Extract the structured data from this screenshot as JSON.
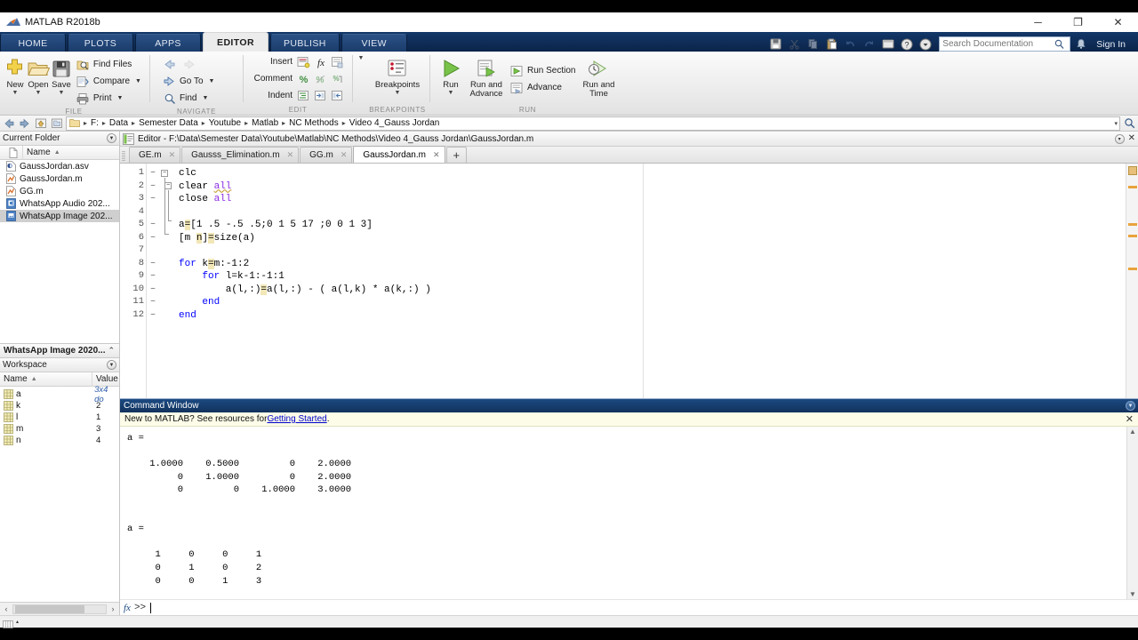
{
  "window": {
    "title": "MATLAB R2018b",
    "minimize": "─",
    "maximize": "❐",
    "close": "✕"
  },
  "ribbon_tabs": [
    {
      "label": "HOME",
      "active": false
    },
    {
      "label": "PLOTS",
      "active": false
    },
    {
      "label": "APPS",
      "active": false
    },
    {
      "label": "EDITOR",
      "active": true
    },
    {
      "label": "PUBLISH",
      "active": false
    },
    {
      "label": "VIEW",
      "active": false
    }
  ],
  "quickaccess": {
    "icons": [
      "save-icon",
      "cut-icon",
      "copy-icon",
      "paste-icon",
      "undo-icon",
      "redo-icon",
      "layout-icon",
      "help-icon",
      "more-icon"
    ],
    "search_placeholder": "Search Documentation",
    "search_value": "",
    "bell_icon": "notification-icon",
    "signin_label": "Sign In"
  },
  "ribbon": {
    "groups": [
      {
        "label": "FILE",
        "big": [
          {
            "label": "New",
            "icon": "new-file-icon",
            "has_caret": true
          },
          {
            "label": "Open",
            "icon": "open-folder-icon",
            "has_caret": true
          },
          {
            "label": "Save",
            "icon": "save-disk-icon",
            "has_caret": true
          }
        ],
        "small": [
          {
            "label": "Find Files",
            "icon": "find-files-icon",
            "caret": false
          },
          {
            "label": "Compare",
            "icon": "compare-icon",
            "caret": true
          },
          {
            "label": "Print",
            "icon": "print-icon",
            "caret": true
          }
        ]
      },
      {
        "label": "NAVIGATE",
        "small": [
          {
            "label": "",
            "icon": "back-arrow-icon",
            "caret": false,
            "dim": true
          },
          {
            "label": "Go To",
            "icon": "goto-icon",
            "caret": true
          },
          {
            "label": "Find",
            "icon": "find-magnifier-icon",
            "caret": true
          }
        ]
      },
      {
        "label": "EDIT",
        "rows": [
          {
            "label": "Insert",
            "icons": [
              "insert-block-icon",
              "function-fx-icon",
              "insert-section-icon"
            ]
          },
          {
            "label": "Comment",
            "icons": [
              "comment-percent-icon",
              "uncomment-icon",
              "wrap-comment-icon"
            ]
          },
          {
            "label": "Indent",
            "icons": [
              "smart-indent-icon",
              "indent-right-icon",
              "indent-left-icon"
            ]
          }
        ]
      },
      {
        "label": "BREAKPOINTS",
        "big": [
          {
            "label": "Breakpoints",
            "icon": "breakpoints-icon",
            "has_caret": true
          }
        ]
      },
      {
        "label": "RUN",
        "big": [
          {
            "label": "Run",
            "icon": "run-play-icon",
            "has_caret": true
          },
          {
            "label": "Run and\nAdvance",
            "icon": "run-advance-icon",
            "has_caret": false
          },
          {
            "label": "Run and\nTime",
            "icon": "run-time-icon",
            "has_caret": false
          }
        ],
        "small": [
          {
            "label": "Run Section",
            "icon": "run-section-icon",
            "caret": false
          },
          {
            "label": "Advance",
            "icon": "advance-icon",
            "caret": false
          }
        ]
      }
    ]
  },
  "address_bar": {
    "back_icon": "back-icon",
    "forward_icon": "forward-icon",
    "up_icon": "up-folder-icon",
    "browse_icon": "browse-folder-icon",
    "crumbs": [
      "F:",
      "Data",
      "Semester Data",
      "Youtube",
      "Matlab",
      "NC Methods",
      "Video 4_Gauss Jordan"
    ],
    "separator": "▸",
    "dropdown": "▾",
    "search_icon": "search-icon"
  },
  "current_folder": {
    "title": "Current Folder",
    "column_header": "Name",
    "sort_arrow": "▲",
    "files": [
      {
        "name": "GaussJordan.asv",
        "icon": "asv-file-icon",
        "selected": false
      },
      {
        "name": "GaussJordan.m",
        "icon": "m-file-icon",
        "selected": false
      },
      {
        "name": "GG.m",
        "icon": "m-file-icon",
        "selected": false
      },
      {
        "name": "WhatsApp Audio 202...",
        "icon": "audio-file-icon",
        "selected": false
      },
      {
        "name": "WhatsApp Image 202...",
        "icon": "image-file-icon",
        "selected": true
      }
    ]
  },
  "details_panel": {
    "title": "WhatsApp Image 2020...",
    "chevron": "⌃"
  },
  "workspace": {
    "title": "Workspace",
    "columns": [
      "Name",
      "Value"
    ],
    "sort_arrow": "▲",
    "variables": [
      {
        "name": "a",
        "value": "3x4 do",
        "italic": true
      },
      {
        "name": "k",
        "value": "2",
        "italic": false
      },
      {
        "name": "l",
        "value": "1",
        "italic": false
      },
      {
        "name": "m",
        "value": "3",
        "italic": false
      },
      {
        "name": "n",
        "value": "4",
        "italic": false
      }
    ]
  },
  "editor": {
    "header_title": "Editor - F:\\Data\\Semester Data\\Youtube\\Matlab\\NC Methods\\Video 4_Gauss Jordan\\GaussJordan.m",
    "header_icon": "editor-icon",
    "tabs": [
      {
        "label": "GE.m",
        "active": false,
        "close": "✕"
      },
      {
        "label": "Gausss_Elimination.m",
        "active": false,
        "close": "✕"
      },
      {
        "label": "GG.m",
        "active": false,
        "close": "✕"
      },
      {
        "label": "GaussJordan.m",
        "active": true,
        "close": "✕"
      }
    ],
    "new_tab_label": "+",
    "lines": [
      {
        "num": "1",
        "dash": "–",
        "code": "clc"
      },
      {
        "num": "2",
        "dash": "–",
        "code": "clear all"
      },
      {
        "num": "3",
        "dash": "–",
        "code": "close all"
      },
      {
        "num": "4",
        "dash": "",
        "code": ""
      },
      {
        "num": "5",
        "dash": "–",
        "code": "a=[1 .5 -.5 .5;0 1 5 17 ;0 0 1 3]"
      },
      {
        "num": "6",
        "dash": "–",
        "code": "[m n]=size(a)"
      },
      {
        "num": "7",
        "dash": "",
        "code": ""
      },
      {
        "num": "8",
        "dash": "–",
        "code": "for k=m:-1:2"
      },
      {
        "num": "9",
        "dash": "–",
        "code": "    for l=k-1:-1:1"
      },
      {
        "num": "10",
        "dash": "–",
        "code": "        a(l,:)=a(l,:) - ( a(l,k) * a(k,:) )"
      },
      {
        "num": "11",
        "dash": "–",
        "code": "    end"
      },
      {
        "num": "12",
        "dash": "–",
        "code": "end"
      }
    ],
    "panel_dropdown": "▾",
    "panel_close": "✕"
  },
  "command_window": {
    "title": "Command Window",
    "notice_prefix": "New to MATLAB? See resources for ",
    "notice_link": "Getting Started",
    "notice_suffix": ".",
    "notice_close": "✕",
    "output": "a =\n\n    1.0000    0.5000         0    2.0000\n         0    1.0000         0    2.0000\n         0         0    1.0000    3.0000\n\n\na =\n\n     1     0     0     1\n     0     1     0     2\n     0     0     1     3\n",
    "prompt_fx": "fx",
    "prompt_symbol": ">>",
    "prompt_value": ""
  },
  "status_bar": {
    "icon": "grid-icon",
    "caret": "▴"
  },
  "colors": {
    "accent_blue": "#12325c",
    "ribbon_tab_bg": "#1b3c6b",
    "active_tab_bg": "#ececec",
    "keyword_blue": "#0000ff",
    "string_purple": "#8a2be2",
    "highlight_yellow": "#f2e7b7",
    "marker_orange": "#e8a33d",
    "notice_bg": "#fcfce8",
    "link_blue": "#0000cc",
    "selected_row": "#cfcfcf"
  }
}
